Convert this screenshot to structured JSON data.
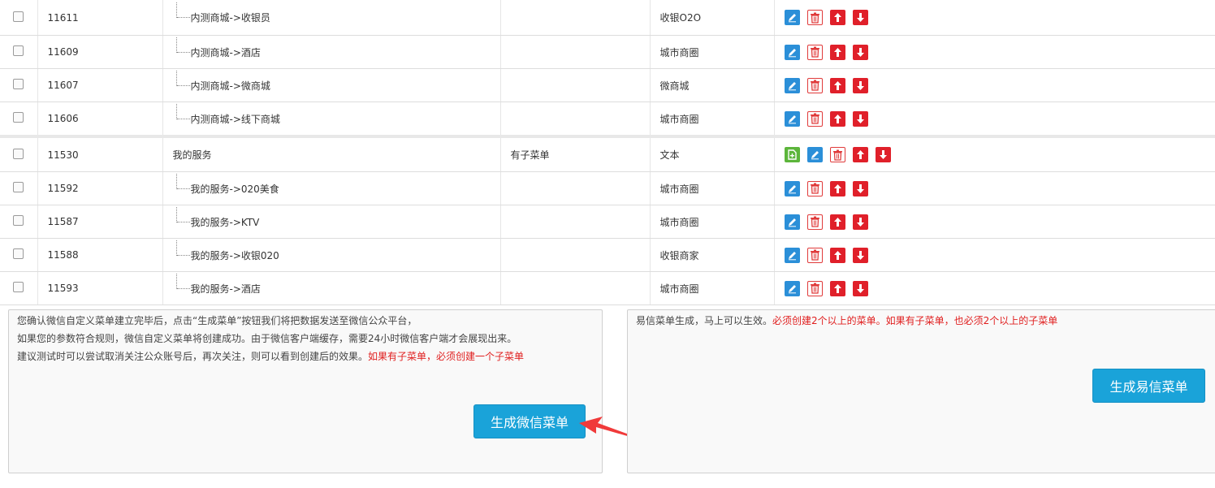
{
  "rows": [
    {
      "id": "11611",
      "name": "内测商城->收银员",
      "child": true,
      "sub": "",
      "type": "收银O2O",
      "add": false
    },
    {
      "id": "11609",
      "name": "内测商城->酒店",
      "child": true,
      "sub": "",
      "type": "城市商圈",
      "add": false
    },
    {
      "id": "11607",
      "name": "内测商城->微商城",
      "child": true,
      "sub": "",
      "type": "微商城",
      "add": false
    },
    {
      "id": "11606",
      "name": "内测商城->线下商城",
      "child": true,
      "sub": "",
      "type": "城市商圈",
      "add": false
    },
    {
      "id": "11530",
      "name": "我的服务",
      "child": false,
      "sub": "有子菜单",
      "type": "文本",
      "add": true
    },
    {
      "id": "11592",
      "name": "我的服务->020美食",
      "child": true,
      "sub": "",
      "type": "城市商圈",
      "add": false
    },
    {
      "id": "11587",
      "name": "我的服务->KTV",
      "child": true,
      "sub": "",
      "type": "城市商圈",
      "add": false
    },
    {
      "id": "11588",
      "name": "我的服务->收银020",
      "child": true,
      "sub": "",
      "type": "收银商家",
      "add": false
    },
    {
      "id": "11593",
      "name": "我的服务->酒店",
      "child": true,
      "sub": "",
      "type": "城市商圈",
      "add": false
    }
  ],
  "action_icons": {
    "add": "add-child-icon",
    "edit": "edit-pencil-icon",
    "delete": "trash-icon",
    "up": "arrow-up-icon",
    "down": "arrow-down-icon"
  },
  "wechat_panel": {
    "line1": "您确认微信自定义菜单建立完毕后，点击“生成菜单”按钮我们将把数据发送至微信公众平台，",
    "line2": "如果您的参数符合规则，微信自定义菜单将创建成功。由于微信客户端缓存，需要24小时微信客户端才会展现出来。",
    "line3": "建议测试时可以尝试取消关注公众账号后，再次关注，则可以看到创建后的效果。",
    "line3_warning": "如果有子菜单，必须创建一个子菜单",
    "button": "生成微信菜单"
  },
  "yixin_panel": {
    "text": "易信菜单生成，马上可以生效。",
    "warning": "必须创建2个以上的菜单。如果有子菜单，也必须2个以上的子菜单",
    "button": "生成易信菜单"
  },
  "colors": {
    "button": "#1aa3d9",
    "warning": "#e01e1e",
    "arrow": "#f03a3a"
  }
}
